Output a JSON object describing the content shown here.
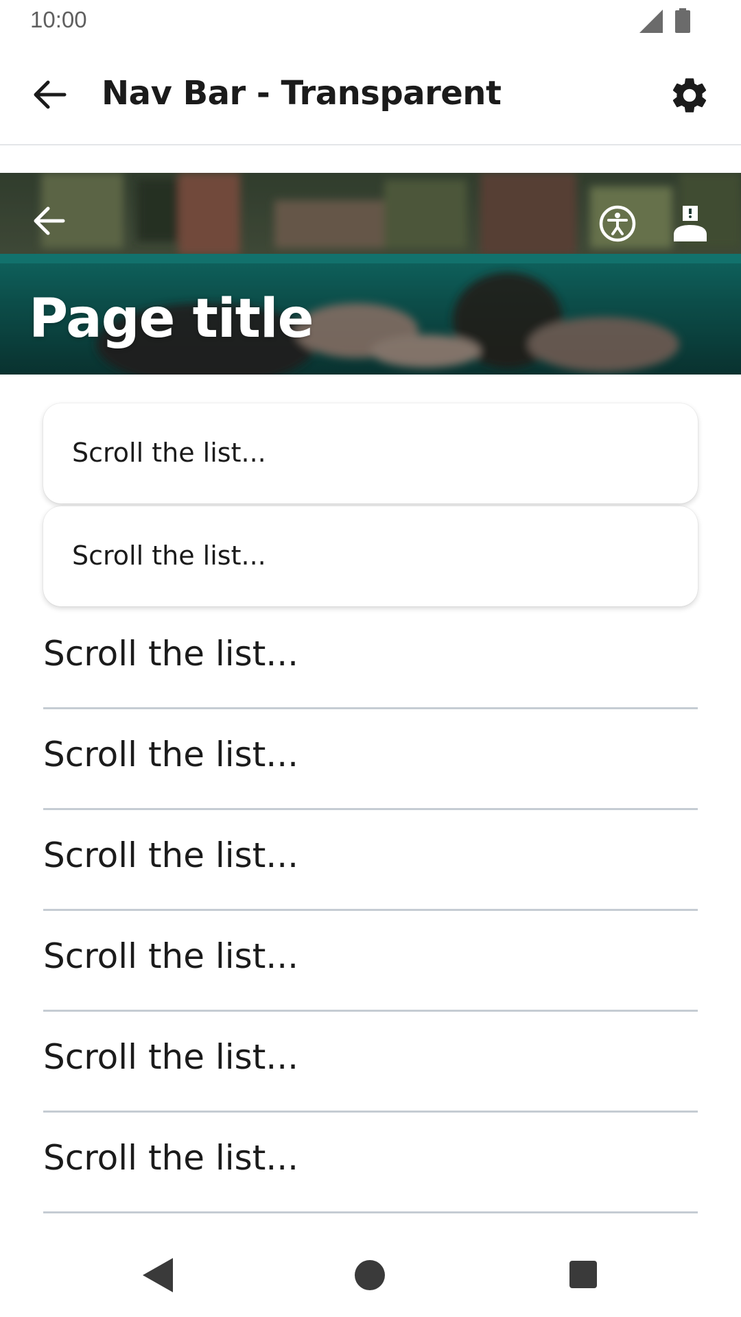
{
  "status_bar": {
    "time": "10:00",
    "icons": [
      "cell-signal-icon",
      "battery-icon"
    ]
  },
  "app_bar": {
    "title": "Nav Bar - Transparent",
    "back_icon": "arrow-back-icon",
    "settings_icon": "gear-icon"
  },
  "hero": {
    "title": "Page title",
    "back_icon": "arrow-back-icon",
    "actions": [
      "accessibility-icon",
      "person-icon"
    ]
  },
  "cards": [
    {
      "label": "Scroll the list..."
    },
    {
      "label": "Scroll the list..."
    }
  ],
  "list": [
    {
      "label": "Scroll the list..."
    },
    {
      "label": "Scroll the list..."
    },
    {
      "label": "Scroll the list..."
    },
    {
      "label": "Scroll the list..."
    },
    {
      "label": "Scroll the list..."
    },
    {
      "label": "Scroll the list..."
    }
  ],
  "nav_bar": {
    "buttons": [
      "nav-back-icon",
      "nav-home-icon",
      "nav-recents-icon"
    ]
  },
  "colors": {
    "text": "#1b1b1b",
    "divider": "#c5ccd3",
    "hero_water": "#0f6e68"
  }
}
